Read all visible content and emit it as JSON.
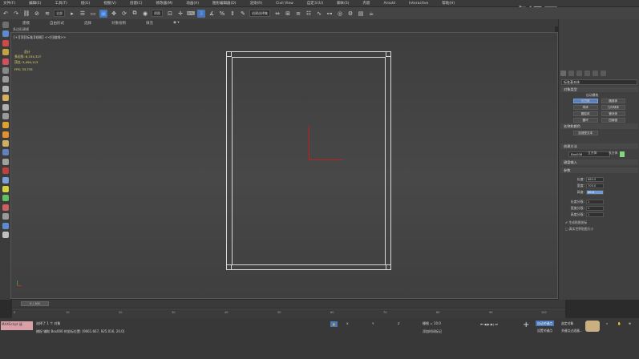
{
  "menubar": {
    "items": [
      "文件(F)",
      "编辑(E)",
      "工具(T)",
      "组(G)",
      "视图(V)",
      "创建(C)",
      "修改器(M)",
      "动画(A)",
      "图形编辑器(D)",
      "渲染(R)",
      "Civil View",
      "自定义(U)",
      "脚本(S)",
      "内容",
      "Arnold",
      "Interactive",
      "帮助(H)"
    ]
  },
  "toolbar": {
    "filter_select": "全部",
    "view_select": "视图",
    "selection_set": "创建选择集"
  },
  "ribbon": {
    "tabs": [
      "建模",
      "自由形式",
      "选择",
      "对象绘制",
      "填充"
    ],
    "sub_label": "多边形建模"
  },
  "viewport": {
    "label": "[+][顶][标准][线框] <<扫描线>>",
    "stats": {
      "total_label": "总计",
      "polys_label": "多边形:",
      "polys_value": "8,154,327",
      "verts_label": "顶点:",
      "verts_value": "5,494,113",
      "fps_label": "FPS:",
      "fps_value": "33.735"
    }
  },
  "command_panel": {
    "dropdown": "标准基本体",
    "object_type_title": "对象类型",
    "autogrid": "自动栅格",
    "objects": [
      "长方体",
      "圆锥体",
      "球体",
      "几何球体",
      "圆柱体",
      "管状体",
      "圆环",
      "四棱锥",
      "茶壶",
      "平面",
      "加强型文本",
      ""
    ],
    "name_color_title": "名称和颜色",
    "object_name": "Box006",
    "swatch_color": "#7fd87f",
    "creation_method_title": "创建方法",
    "creation_cube": "立方体",
    "creation_box": "长方体",
    "keyboard_title": "键盘输入",
    "params_title": "参数",
    "params": [
      {
        "label": "长度:",
        "value": "880.0"
      },
      {
        "label": "宽度:",
        "value": "700.0"
      },
      {
        "label": "高度:",
        "value": "20.0"
      }
    ],
    "segs": [
      {
        "label": "长度分段:",
        "value": "1"
      },
      {
        "label": "宽度分段:",
        "value": "1"
      },
      {
        "label": "高度分段:",
        "value": "1"
      }
    ],
    "gen_uv": "生成贴图坐标",
    "real_world": "真实世界贴图大小"
  },
  "timeline": {
    "slider": "0 / 100",
    "ticks": [
      "0",
      "10",
      "20",
      "30",
      "40",
      "50",
      "60",
      "70",
      "80",
      "90",
      "100"
    ]
  },
  "status": {
    "maxscript": "MAXScript 迷",
    "selected": "选择了 1 个 对象",
    "prompt": "捕捉 辅助 Box006 的坐标位置: [9061.667, 925.016, 20.0]",
    "grid": "栅格 = 10.0",
    "add_time_tag": "添加时间标记",
    "auto_key": "自动关键点",
    "set_key": "设置关键点",
    "selected_obj": "选定对象",
    "key_filter": "关键点过滤器..."
  },
  "watermark": "虎课网"
}
